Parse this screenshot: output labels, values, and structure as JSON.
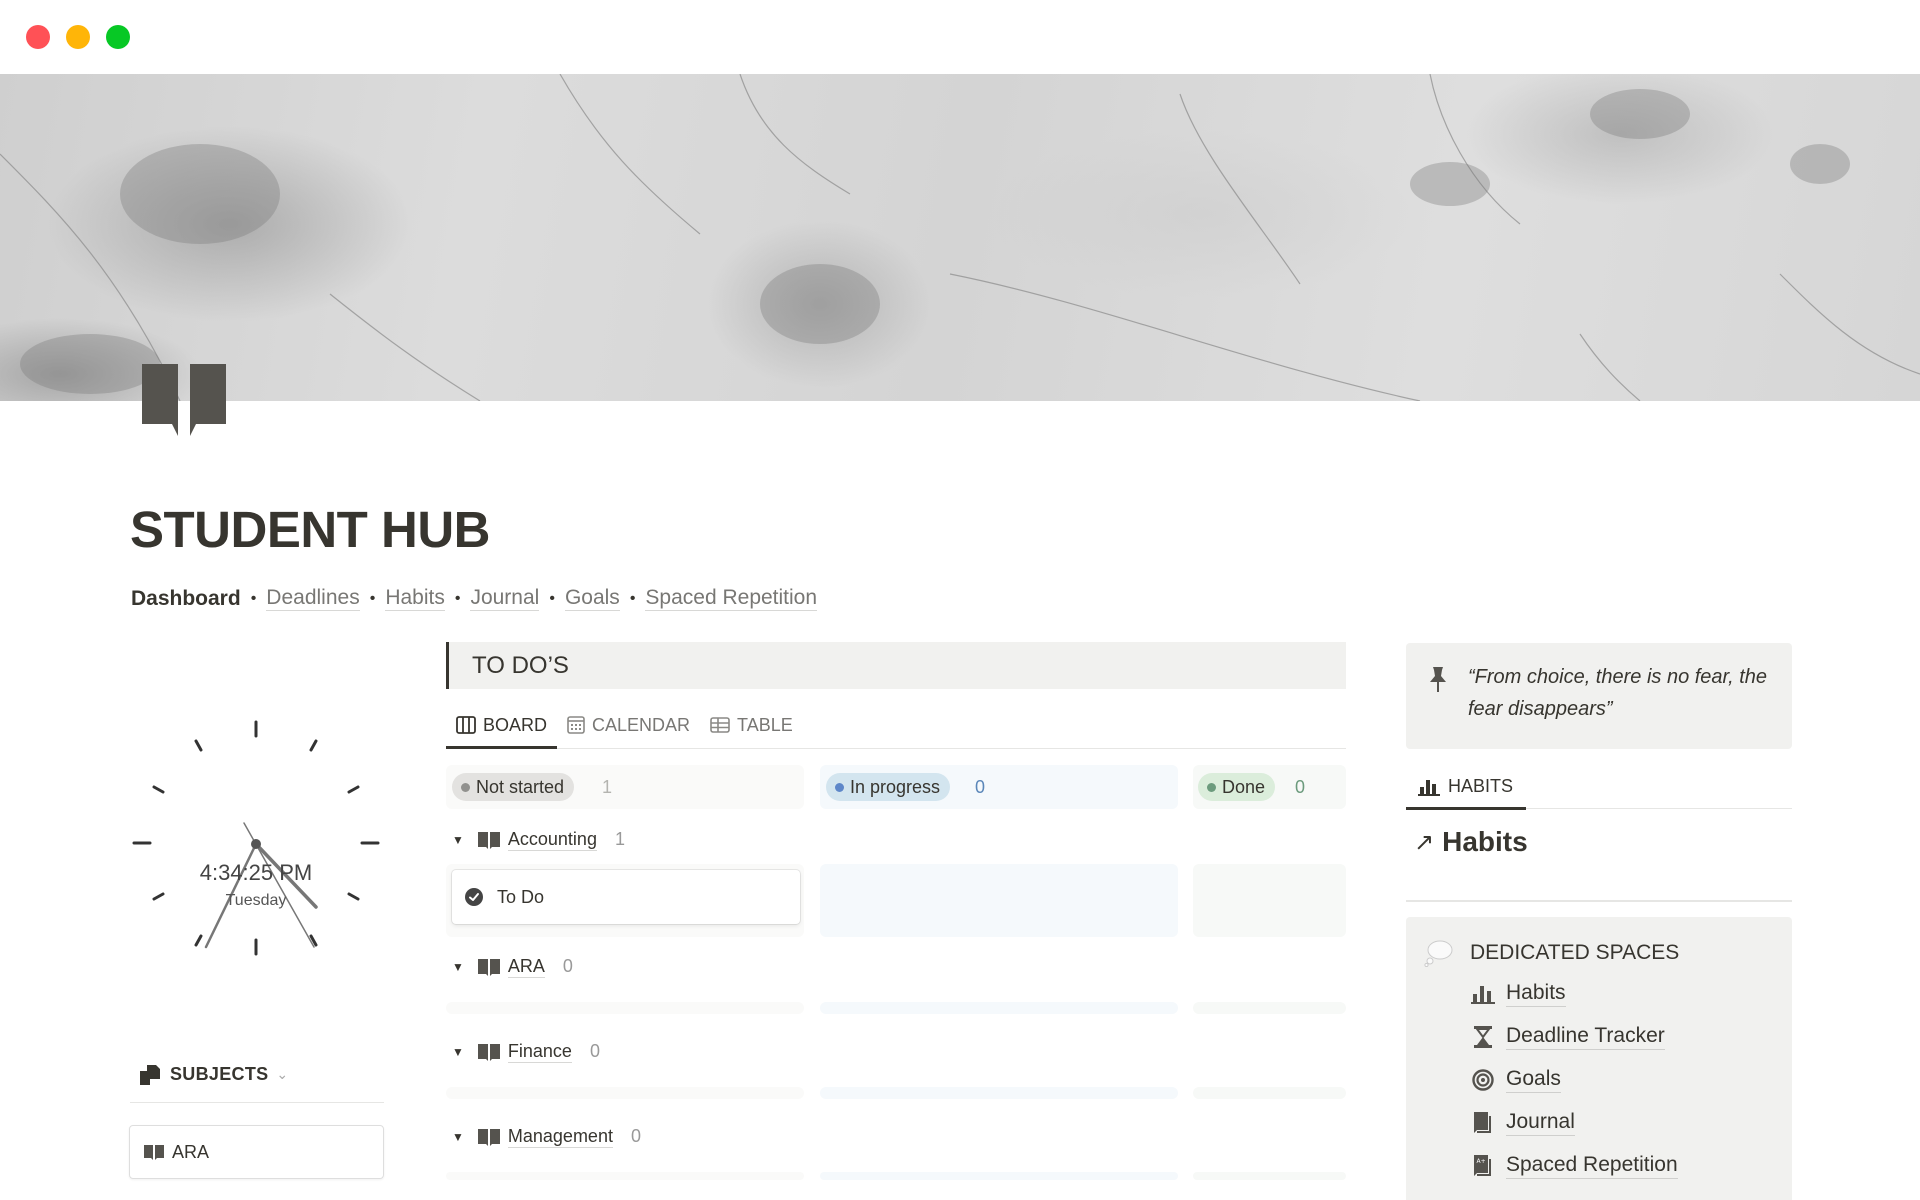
{
  "window": {
    "traffic_lights": [
      "close",
      "minimize",
      "maximize"
    ]
  },
  "page": {
    "title": "STUDENT HUB",
    "icon": "book-open-icon"
  },
  "nav": {
    "current": "Dashboard",
    "separator": "•",
    "links": [
      "Deadlines",
      "Habits",
      "Journal",
      "Goals",
      "Spaced Repetition"
    ]
  },
  "clock": {
    "time": "4:34:25 PM",
    "day": "Tuesday"
  },
  "subjects": {
    "header": "SUBJECTS",
    "chevron": "⌄",
    "items": [
      {
        "label": "ARA",
        "icon": "book-open-icon"
      }
    ]
  },
  "todos": {
    "header": "TO DO’S",
    "tabs": [
      {
        "label": "BOARD",
        "icon": "board-icon",
        "active": true
      },
      {
        "label": "CALENDAR",
        "icon": "calendar-icon",
        "active": false
      },
      {
        "label": "TABLE",
        "icon": "table-icon",
        "active": false
      }
    ],
    "columns": [
      {
        "label": "Not started",
        "count": "1",
        "dot_color": "#91918e",
        "pill_bg": "#e3e2e0",
        "count_color": "#b4b4b0"
      },
      {
        "label": "In progress",
        "count": "0",
        "dot_color": "#5e87c9",
        "pill_bg": "#d3e5ef",
        "count_color": "#5b87b9"
      },
      {
        "label": "Done",
        "count": "0",
        "dot_color": "#6c9b7d",
        "pill_bg": "#dbeddb",
        "count_color": "#6c9b7d"
      }
    ],
    "groups": [
      {
        "name": "Accounting",
        "count": "1",
        "cards": [
          {
            "title": "To Do"
          }
        ]
      },
      {
        "name": "ARA",
        "count": "0",
        "cards": []
      },
      {
        "name": "Finance",
        "count": "0",
        "cards": []
      },
      {
        "name": "Management",
        "count": "0",
        "cards": []
      }
    ]
  },
  "callout": {
    "icon": "pushpin-icon",
    "quote": "“From choice, there is no fear, the fear disappears”"
  },
  "habits_view": {
    "tab_label": "HABITS",
    "link_arrow": "↗",
    "link_label": "Habits"
  },
  "dedicated_spaces": {
    "header": "DEDICATED SPACES",
    "items": [
      {
        "label": "Habits",
        "icon": "bar-chart-icon"
      },
      {
        "label": "Deadline Tracker",
        "icon": "hourglass-icon"
      },
      {
        "label": "Goals",
        "icon": "target-icon"
      },
      {
        "label": "Journal",
        "icon": "journal-icon"
      },
      {
        "label": "Spaced Repetition",
        "icon": "grade-book-icon"
      }
    ]
  },
  "colors": {
    "text": "#37352f",
    "muted": "#787774",
    "callout_bg": "#f1f1ef"
  }
}
